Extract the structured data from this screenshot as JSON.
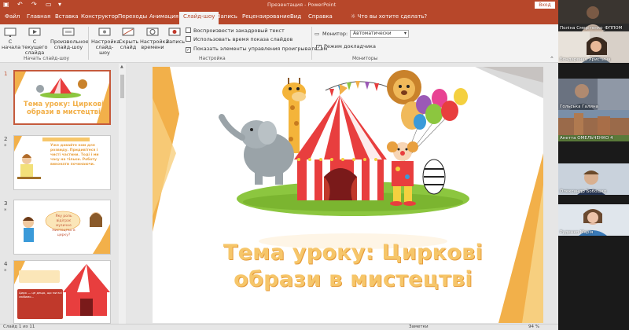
{
  "window": {
    "title": "Презентация - PowerPoint",
    "signin_label": "Вход"
  },
  "tabs": {
    "items": [
      "Файл",
      "Главная",
      "Вставка",
      "Конструктор",
      "Переходы",
      "Анимация",
      "Слайд-шоу",
      "Запись",
      "Рецензирование",
      "Вид",
      "Справка"
    ],
    "active": "Слайд-шоу",
    "search_label": "Что вы хотите сделать?"
  },
  "ribbon": {
    "from_start": "С начала",
    "from_current": "С текущего слайда",
    "custom_show": "Произвольное слайд-шоу",
    "group_start": "Начать слайд-шоу",
    "setup_show": "Настройка слайд-шоу",
    "hide_slide": "Скрыть слайд",
    "rehearse": "Настройка времени",
    "record": "Запись",
    "chk_narration": "Воспроизвести закадровый текст",
    "chk_timings": "Использовать время показа слайдов",
    "chk_controls": "Показать элементы управления проигрывателем",
    "group_setup": "Настройка",
    "monitor_label": "Монитор:",
    "monitor_value": "Автоматически",
    "presenter_view": "Режим докладчика",
    "group_monitors": "Мониторы"
  },
  "slides": [
    {
      "number": "1",
      "title": "Тема уроку: Циркові образи в мистецтві"
    },
    {
      "number": "2",
      "text": "Уже давайте нам для розвиду. Придивітеся і чисті частини. Тоді і ми часу на тільки. Роботу виконати починаючи."
    },
    {
      "number": "3",
      "text": "Яку роль відіграє музичне мистецтво в цирку?"
    },
    {
      "number": "4",
      "text": "Цирк — це дещо, що ми всі любимо..."
    }
  ],
  "main_slide": {
    "title_line1": "Тема уроку: Циркові",
    "title_line2": "образи в мистецтві"
  },
  "status": {
    "slide_counter": "Слайд 1 из 11",
    "notes_label": "Заметки",
    "zoom": "94 %"
  },
  "participants": [
    {
      "name": "Поліна Смерітенко_ФППОМ"
    },
    {
      "name": "Бондаренко Христина"
    },
    {
      "name": "Гольська Галина"
    },
    {
      "name": "Анетта ОМЕЛЬЧЕНКО 4"
    },
    {
      "name": "Олександр Бобошко"
    },
    {
      "name": "Руденко Марія"
    }
  ],
  "colors": {
    "accent": "#b7472a",
    "slide_title": "#f6c66a"
  }
}
